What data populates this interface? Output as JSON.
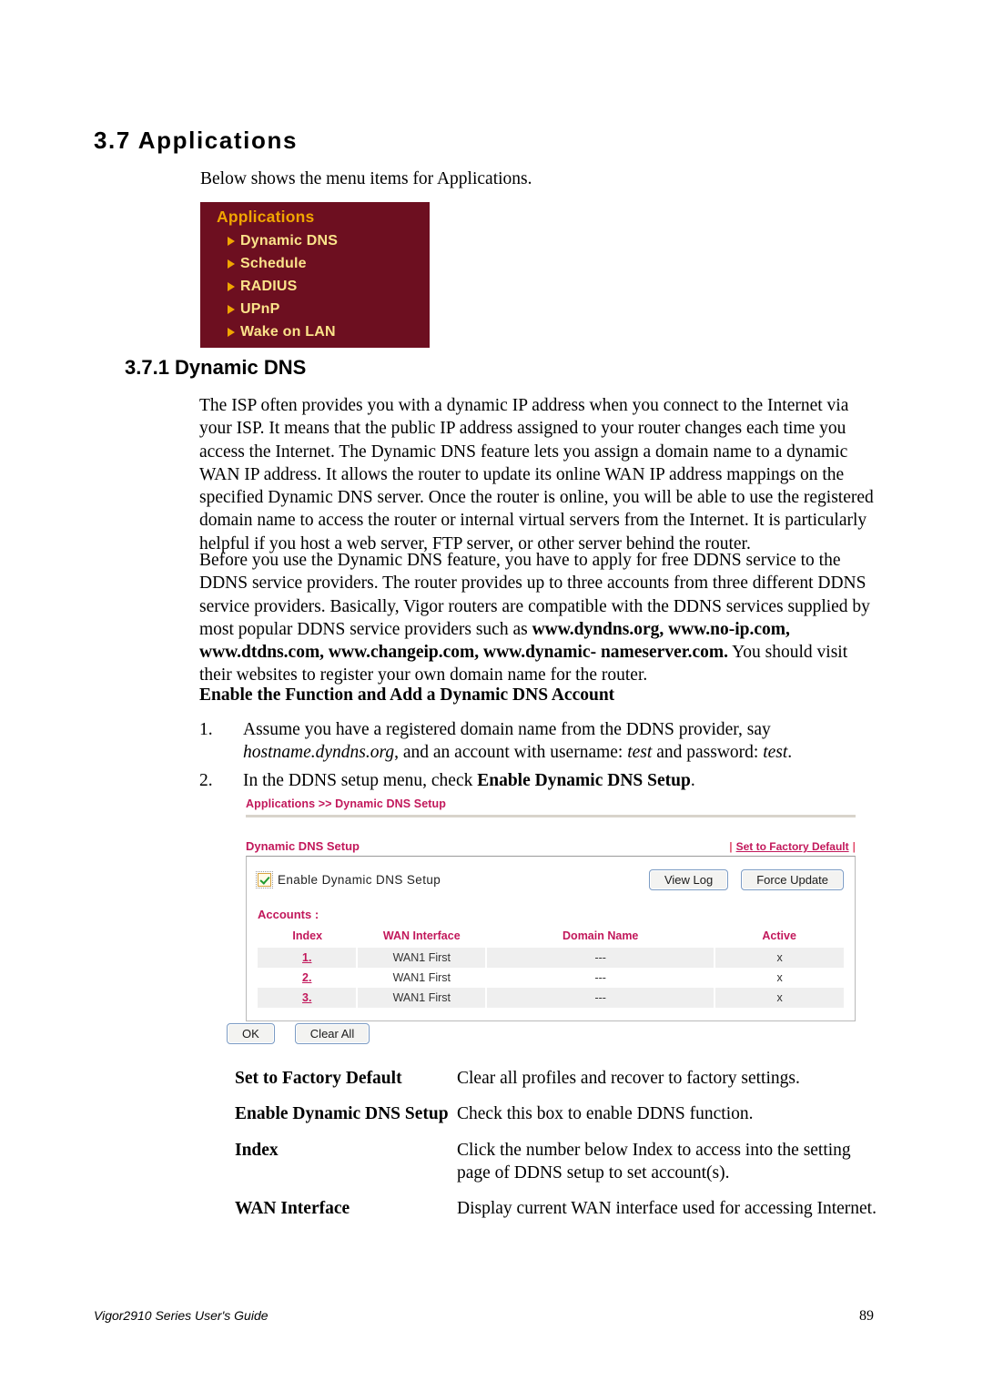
{
  "section": {
    "heading": "3.7 Applications",
    "intro": "Below shows the menu items for Applications."
  },
  "app_menu": {
    "title": "Applications",
    "items": [
      {
        "label": "Dynamic DNS"
      },
      {
        "label": "Schedule"
      },
      {
        "label": "RADIUS"
      },
      {
        "label": "UPnP"
      },
      {
        "label": "Wake on LAN"
      }
    ],
    "colors": {
      "background": "#6d0f20",
      "title": "#f0a500",
      "item": "#fbe38a",
      "arrow": "#f0a500"
    }
  },
  "subsection": {
    "heading": "3.7.1 Dynamic DNS",
    "paragraph1": "The ISP often provides you with a dynamic IP address when you connect to the Internet via your ISP. It means that the public IP address assigned to your router changes each time you access the Internet. The Dynamic DNS feature lets you assign a domain name to a dynamic WAN IP address. It allows the router to update its online WAN IP address mappings on the specified Dynamic DNS server. Once the router is online, you will be able to use the registered domain name to access the router or internal virtual servers from the Internet. It is particularly helpful if you host a web server, FTP server, or other server behind the router.",
    "paragraph2_part1": "Before you use the Dynamic DNS feature, you have to apply for free DDNS service to the DDNS service providers. The router provides up to three accounts from three different DDNS service providers. Basically, Vigor routers are compatible with the DDNS services supplied by most popular DDNS service providers such as ",
    "paragraph2_bold": "www.dyndns.org, www.no-ip.com, www.dtdns.com, www.changeip.com, www.dynamic- nameserver.com.",
    "paragraph2_part2": " You should visit their websites to register your own domain name for the router."
  },
  "procedure": {
    "heading": "Enable the Function and Add a Dynamic DNS Account",
    "steps": [
      {
        "number": "1.",
        "text_part1": "Assume you have a registered domain name from the DDNS provider, say ",
        "text_italic1": "hostname.dyndns.org",
        "text_part2": ", and an account with username: ",
        "text_italic2": "test",
        "text_part3": " and password: ",
        "text_italic3": "test",
        "text_part4": "."
      },
      {
        "number": "2.",
        "text_part1": "In the DDNS setup menu, check ",
        "text_bold": "Enable Dynamic DNS Setup",
        "text_part2": "."
      }
    ]
  },
  "router_ui": {
    "breadcrumb": "Applications >> Dynamic DNS Setup",
    "panel_title": "Dynamic DNS Setup",
    "factory_default_link": "Set to Factory Default",
    "separator": "|",
    "enable_checkbox_label": "Enable Dynamic DNS Setup",
    "enable_checkbox_checked": true,
    "buttons": {
      "view_log": "View Log",
      "force_update": "Force Update",
      "ok": "OK",
      "clear_all": "Clear All"
    },
    "accounts_label": "Accounts :",
    "table": {
      "headers": [
        "Index",
        "WAN Interface",
        "Domain Name",
        "Active"
      ],
      "rows": [
        {
          "index": "1.",
          "wan": "WAN1 First",
          "domain": "---",
          "active": "x"
        },
        {
          "index": "2.",
          "wan": "WAN1 First",
          "domain": "---",
          "active": "x"
        },
        {
          "index": "3.",
          "wan": "WAN1 First",
          "domain": "---",
          "active": "x"
        }
      ]
    },
    "accent_color": "#c2185b"
  },
  "definitions": [
    {
      "term": "Set to Factory Default",
      "description": "Clear all profiles and recover to factory settings."
    },
    {
      "term": "Enable Dynamic DNS Setup",
      "description": "Check this box to enable DDNS function."
    },
    {
      "term": "Index",
      "description": "Click the number below Index to access into the setting page of DDNS setup to set account(s)."
    },
    {
      "term": "WAN Interface",
      "description": "Display current WAN interface used for accessing Internet."
    }
  ],
  "footer": {
    "left": "Vigor2910 Series User's Guide",
    "page_number": "89"
  }
}
